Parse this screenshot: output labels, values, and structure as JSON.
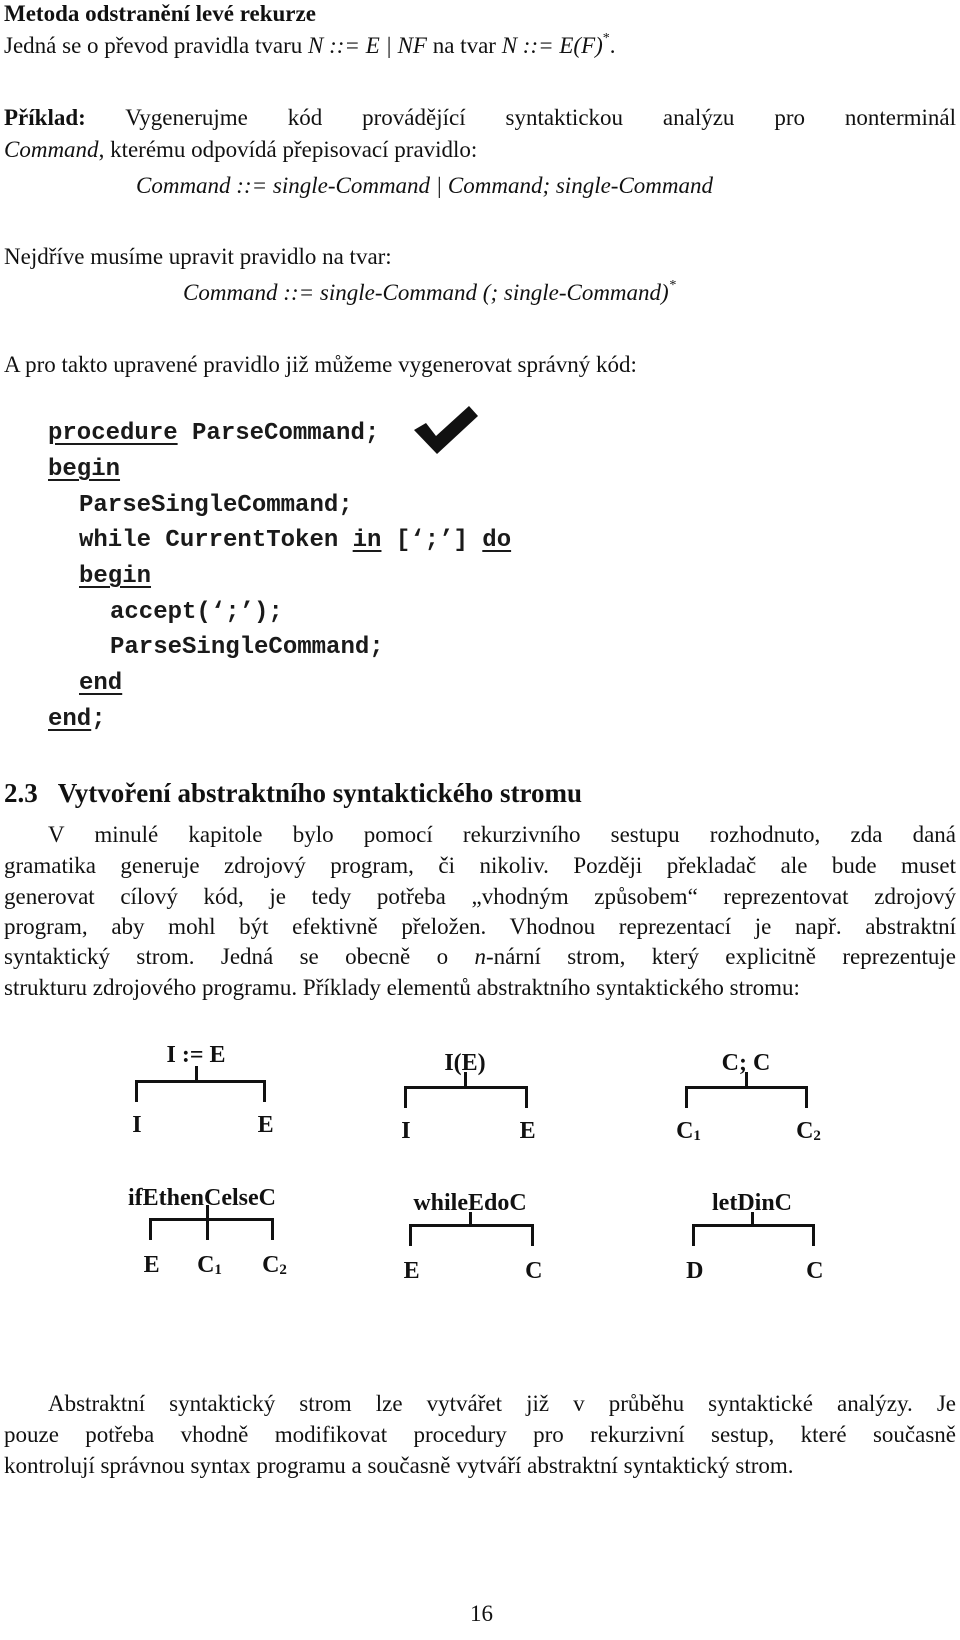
{
  "section_left_recursion": {
    "title": "Metoda odstranění levé rekurze",
    "intro_prefix": "Jedná se o převod pravidla tvaru ",
    "intro_rule_from": "N ::= E | NF",
    "intro_middle": "  na tvar ",
    "intro_rule_to": "N ::= E(F)",
    "intro_star": "*",
    "intro_end": "."
  },
  "example": {
    "label": "Příklad:",
    "text_line1": " Vygenerujme kód provádějící syntaktickou analýzu pro nonterminál",
    "nonterminal": "Command",
    "text_line2": ", kterému odpovídá přepisovací pravidlo:",
    "rule": "Command ::= single-Command | Command; single-Command",
    "transform_intro": "Nejdříve musíme upravit pravidlo na tvar:",
    "transformed_rule": "Command ::= single-Command (; single-Command)",
    "transformed_star": "*",
    "code_intro": "A pro takto upravené pravidlo již můžeme vygenerovat správný kód:"
  },
  "code": {
    "lines": [
      {
        "kw": "procedure",
        "rest": " ParseCommand;"
      },
      {
        "kw": "begin",
        "rest": ""
      },
      {
        "pre": "ParseSingleCommand;"
      },
      {
        "pre": "while CurrentToken ",
        "kw": "in",
        "mid": " [‘;’] ",
        "kw2": "do"
      },
      {
        "kw": "begin",
        "rest": ""
      },
      {
        "pre": "accept(‘;’);"
      },
      {
        "pre": "ParseSingleCommand;"
      },
      {
        "kw": "end",
        "rest": ""
      },
      {
        "kw": "end",
        "rest": ";"
      }
    ],
    "checkmark_icon": "check-icon"
  },
  "section_ast": {
    "heading_number": "2.3",
    "heading_title": "Vytvoření abstraktního syntaktického stromu",
    "para1": [
      "V minulé kapitole bylo pomocí rekurzivního sestupu rozhodnuto, zda daná",
      "gramatika generuje zdrojový program, či nikoliv. Později překladač ale bude muset",
      "generovat cílový kód, je tedy potřeba „vhodným způsobem“ reprezentovat zdrojový",
      "program, aby mohl být efektivně přeložen. Vhodnou reprezentací je např. abstraktní"
    ],
    "para1_line5_prefix": "syntaktický strom. Jedná se obecně o ",
    "para1_line5_italic": "n",
    "para1_line5_suffix": "-nární strom, který explicitně reprezentuje",
    "para1_line6": "strukturu zdrojového programu. Příklady elementů abstraktního syntaktického stromu:",
    "trees": [
      {
        "root": "I := E",
        "children": [
          "I",
          "E"
        ]
      },
      {
        "root": "I(E)",
        "children": [
          "I",
          "E"
        ]
      },
      {
        "root": "C; C",
        "children": [
          {
            "base": "C",
            "sub": "1"
          },
          {
            "base": "C",
            "sub": "2"
          }
        ]
      },
      {
        "root": "ifEthenCelseC",
        "children": [
          "E",
          {
            "base": "C",
            "sub": "1"
          },
          {
            "base": "C",
            "sub": "2"
          }
        ]
      },
      {
        "root": "whileEdoC",
        "children": [
          "E",
          "C"
        ]
      },
      {
        "root": "letDinC",
        "children": [
          "D",
          "C"
        ]
      }
    ],
    "para2": [
      "Abstraktní syntaktický strom lze vytvářet již v průběhu syntaktické analýzy. Je",
      "pouze potřeba vhodně modifikovat procedury pro rekurzivní sestup, které současně",
      "kontrolují správnou syntax programu a současně vytváří abstraktní syntaktický strom."
    ]
  },
  "page_number": "16"
}
